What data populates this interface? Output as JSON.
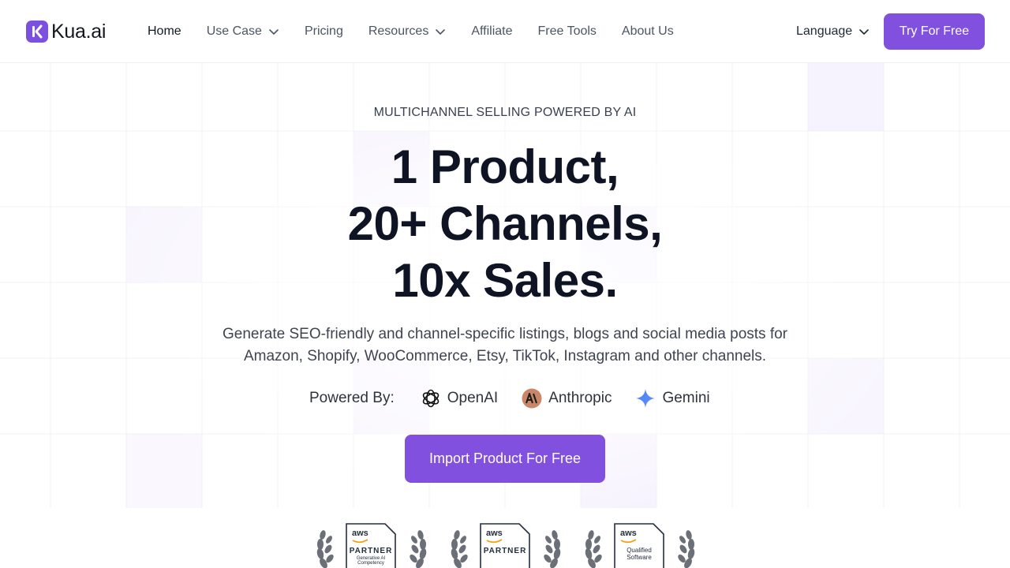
{
  "header": {
    "logo_text": "Kua.ai",
    "nav": [
      {
        "label": "Home",
        "active": true,
        "dropdown": false
      },
      {
        "label": "Use Case",
        "active": false,
        "dropdown": true
      },
      {
        "label": "Pricing",
        "active": false,
        "dropdown": false
      },
      {
        "label": "Resources",
        "active": false,
        "dropdown": true
      },
      {
        "label": "Affiliate",
        "active": false,
        "dropdown": false
      },
      {
        "label": "Free Tools",
        "active": false,
        "dropdown": false
      },
      {
        "label": "About Us",
        "active": false,
        "dropdown": false
      }
    ],
    "language_label": "Language",
    "cta_label": "Try For Free"
  },
  "hero": {
    "eyebrow": "MULTICHANNEL SELLING POWERED BY AI",
    "headline_lines": [
      "1 Product,",
      "20+ Channels,",
      "10x Sales."
    ],
    "subtitle_lines": [
      "Generate SEO-friendly and channel-specific listings, blogs and social media posts for",
      "Amazon, Shopify, WooCommerce, Etsy, TikTok, Instagram and other channels."
    ],
    "powered_by_label": "Powered By:",
    "providers": [
      {
        "name": "OpenAI",
        "icon": "openai-icon"
      },
      {
        "name": "Anthropic",
        "icon": "anthropic-icon"
      },
      {
        "name": "Gemini",
        "icon": "gemini-icon"
      }
    ],
    "import_button_label": "Import Product For Free"
  },
  "badges": [
    {
      "brand": "aws",
      "title": "PARTNER",
      "subtitle": "Generative AI Competency"
    },
    {
      "brand": "aws",
      "title": "PARTNER",
      "subtitle": ""
    },
    {
      "brand": "aws",
      "title": "Qualified Software",
      "subtitle": ""
    }
  ],
  "colors": {
    "accent": "#8250df",
    "heading": "#0f1424",
    "body_text": "#3f4451",
    "grid_line": "#eef0f3",
    "grid_tint": "#f6f2fe"
  }
}
